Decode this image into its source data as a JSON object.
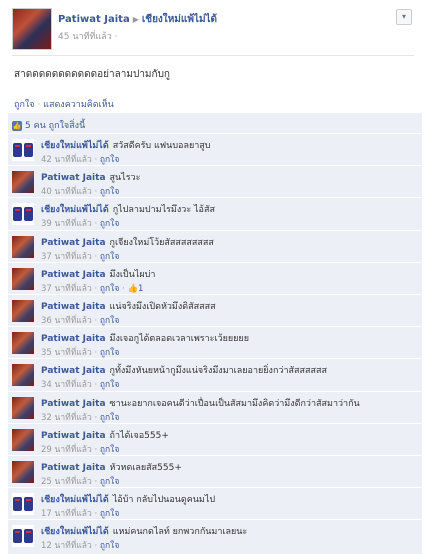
{
  "post": {
    "author": "Patiwat Jaita",
    "target": "เชียงใหม่แพ้ไม่ได้",
    "time": "45 นาทีที่แล้ว",
    "message": "สาดดดดดดดดดดดอย่าลามปามกับกู",
    "actions": {
      "like": "ถูกใจ",
      "separator": " · ",
      "comment": "แสดงความคิดเห็น"
    },
    "likes_summary": "5 คน ถูกใจสิ่งนี้"
  },
  "comments": [
    {
      "author": "เชียงใหม่แพ้ไม่ได้",
      "avatar": "shirt",
      "text": "สวัสดีครับ แฟนบอลยาสูบ",
      "time": "42 นาทีที่แล้ว",
      "like": "ถูกใจ",
      "like_count": ""
    },
    {
      "author": "Patiwat Jaita",
      "avatar": "person",
      "text": "สูนไรวะ",
      "time": "40 นาทีที่แล้ว",
      "like": "ถูกใจ",
      "like_count": ""
    },
    {
      "author": "เชียงใหม่แพ้ไม่ได้",
      "avatar": "shirt",
      "text": "กูไปลามปามไรมึงวะ ไอ้สัส",
      "time": "39 นาทีที่แล้ว",
      "like": "ถูกใจ",
      "like_count": ""
    },
    {
      "author": "Patiwat Jaita",
      "avatar": "person",
      "text": "กูเจียงใหม่โว้ยสัสสสสสสสส",
      "time": "37 นาทีที่แล้ว",
      "like": "ถูกใจ",
      "like_count": ""
    },
    {
      "author": "Patiwat Jaita",
      "avatar": "person",
      "text": "มึงเป็นไผบ่า",
      "time": "37 นาทีที่แล้ว",
      "like": "ถูกใจ",
      "like_count": "1"
    },
    {
      "author": "Patiwat Jaita",
      "avatar": "person",
      "text": "แน่จริงมึงเปิดหัวมึงดิสัสสสส",
      "time": "36 นาทีที่แล้ว",
      "like": "ถูกใจ",
      "like_count": ""
    },
    {
      "author": "Patiwat Jaita",
      "avatar": "person",
      "text": "มึงเจอกูได้ตลอดเวลาเพราะเว้ยยยยย",
      "time": "35 นาทีที่แล้ว",
      "like": "ถูกใจ",
      "like_count": ""
    },
    {
      "author": "Patiwat Jaita",
      "avatar": "person",
      "text": "กูทั้งมึงหันยหน้ากูมึงแน่จริงมึงมาเลยอายยิ่งกว่าสัสสสสสส",
      "time": "34 นาทีที่แล้ว",
      "like": "ถูกใจ",
      "like_count": ""
    },
    {
      "author": "Patiwat Jaita",
      "avatar": "person",
      "text": "ซานะอยากเจอคนดีว่าเปื่อนเป็นสัสมามึงคิดว่ามึงดีกว่าสัสมาว่ากัน",
      "time": "32 นาทีที่แล้ว",
      "like": "ถูกใจ",
      "like_count": ""
    },
    {
      "author": "Patiwat Jaita",
      "avatar": "person",
      "text": "ถ้าได้เจอ555+",
      "time": "29 นาทีที่แล้ว",
      "like": "ถูกใจ",
      "like_count": ""
    },
    {
      "author": "Patiwat Jaita",
      "avatar": "person",
      "text": "หัวหดเลยสัส555+",
      "time": "25 นาทีที่แล้ว",
      "like": "ถูกใจ",
      "like_count": ""
    },
    {
      "author": "เชียงใหม่แพ้ไม่ได้",
      "avatar": "shirt",
      "text": "ไอ้บ้า กลับไปนอนดูคนมไป",
      "time": "17 นาทีที่แล้ว",
      "like": "ถูกใจ",
      "like_count": ""
    },
    {
      "author": "เชียงใหม่แพ้ไม่ได้",
      "avatar": "shirt",
      "text": "แหม่คนกดไลท์ ยกพวกกันมาเลยนะ",
      "time": "12 นาทีที่แล้ว",
      "like": "ถูกใจ",
      "like_count": ""
    }
  ]
}
